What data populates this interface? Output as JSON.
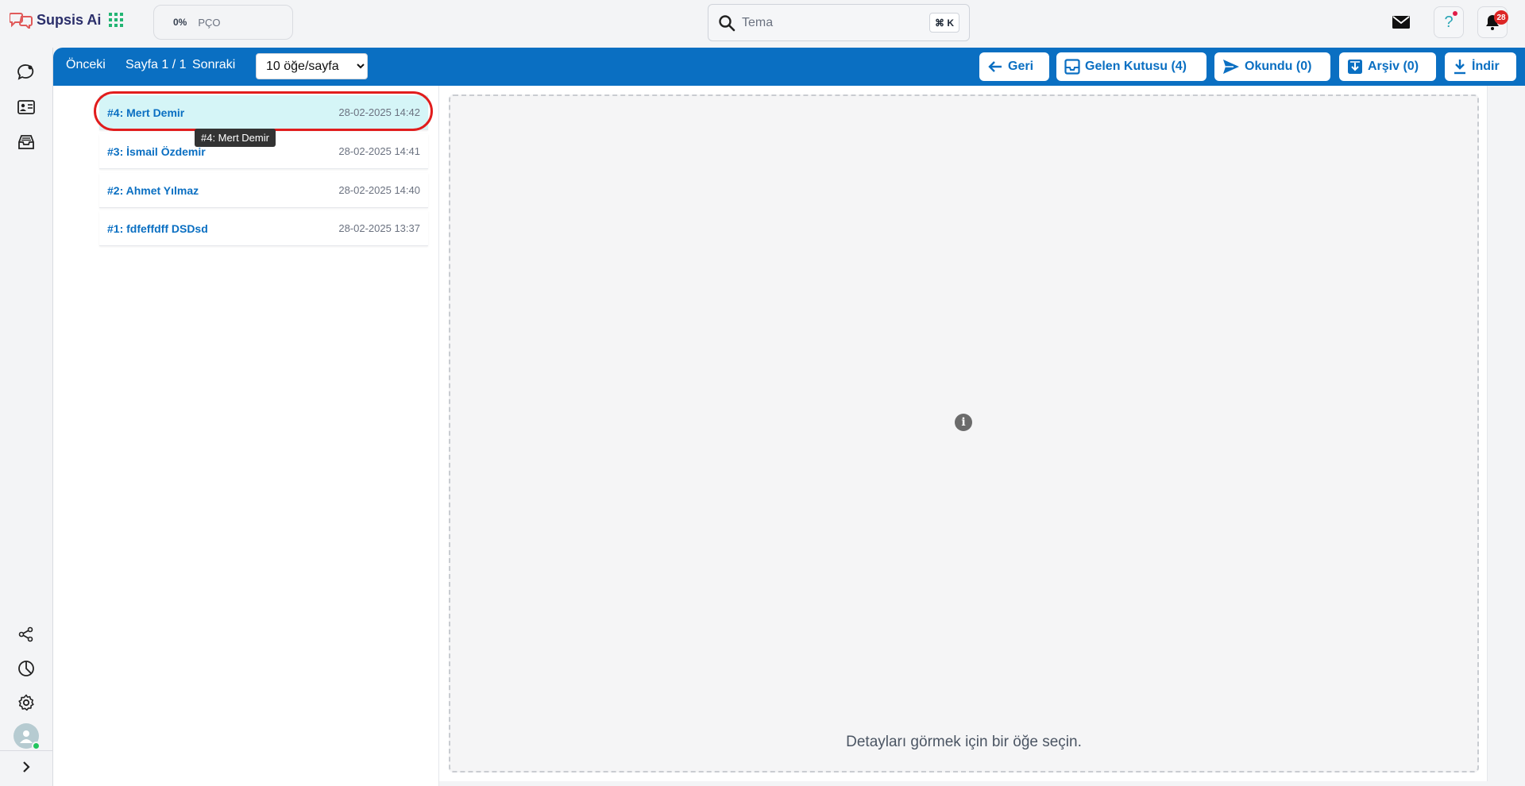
{
  "brand": {
    "name": "Supsis Ai"
  },
  "progress": {
    "percent": "0%",
    "label": "PÇO"
  },
  "search": {
    "value": "Tema",
    "shortcut": "⌘ K"
  },
  "notifications": {
    "count": "28"
  },
  "help": {
    "symbol": "?"
  },
  "toolbar": {
    "prev": "Önceki",
    "page": "Sayfa 1 / 1",
    "next": "Sonraki",
    "per_page": "10 öğe/sayfa",
    "per_page_options": [
      "10 öğe/sayfa"
    ],
    "back_label": "Geri",
    "inbox_label": "Gelen Kutusu (4)",
    "read_label": "Okundu (0)",
    "archive_label": "Arşiv (0)",
    "download_label": "İndir"
  },
  "list": {
    "items": [
      {
        "title": "#4: Mert Demir",
        "date": "28-02-2025 14:42",
        "active": true
      },
      {
        "title": "#3: İsmail Özdemir",
        "date": "28-02-2025 14:41",
        "active": false
      },
      {
        "title": "#2: Ahmet Yılmaz",
        "date": "28-02-2025 14:40",
        "active": false
      },
      {
        "title": "#1: fdfeffdff DSDsd",
        "date": "28-02-2025 13:37",
        "active": false
      }
    ],
    "tooltip": "#4: Mert Demir"
  },
  "detail": {
    "empty_message": "Detayları görmek için bir öğe seçin."
  },
  "colors": {
    "primary": "#0a6fc2",
    "active_row": "#d5f5f7",
    "highlight": "#e11d1d",
    "badge": "#dc2626"
  },
  "icons": {
    "rail_top": [
      "chat-icon",
      "contact-card-icon",
      "inbox-tray-icon"
    ],
    "rail_bottom": [
      "share-icon",
      "pie-chart-icon",
      "settings-icon",
      "avatar",
      "chevron-right-icon"
    ]
  }
}
